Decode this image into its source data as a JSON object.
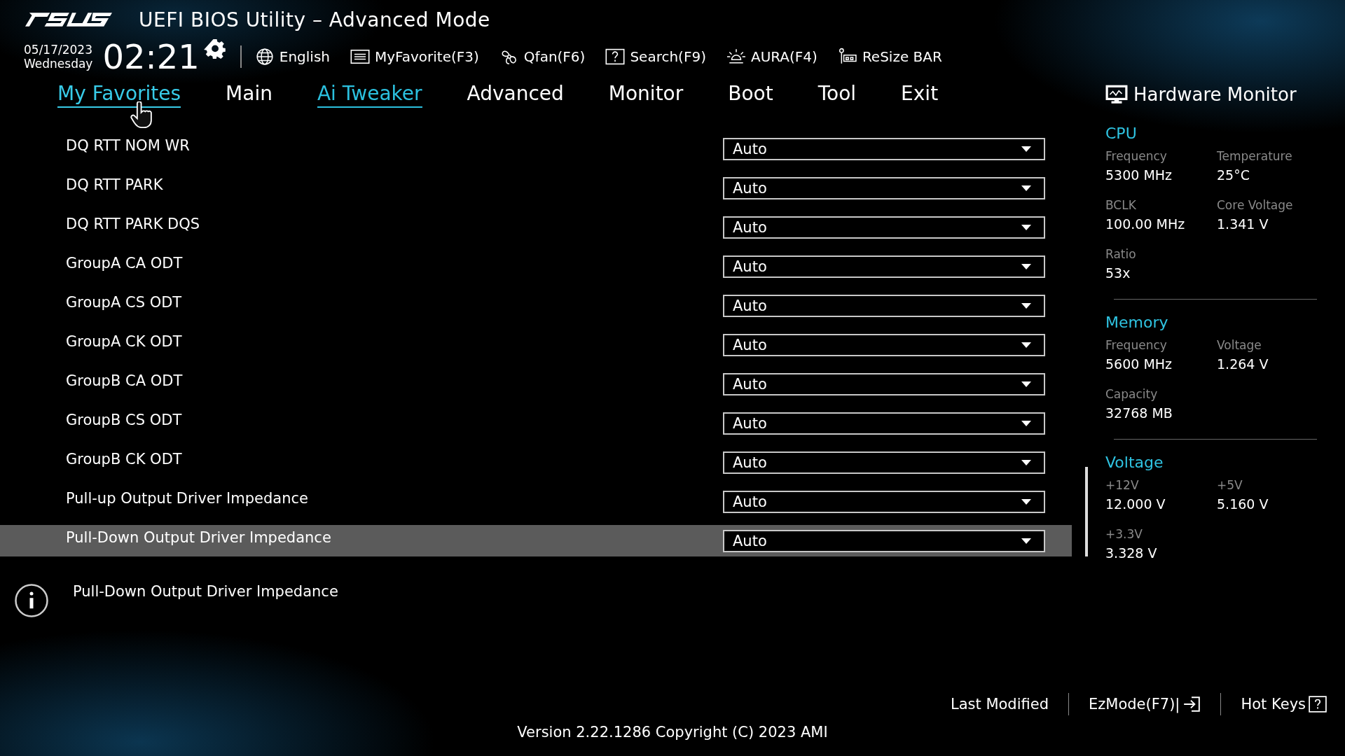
{
  "header": {
    "title": "UEFI BIOS Utility – Advanced Mode",
    "date": "05/17/2023",
    "weekday": "Wednesday",
    "time": "02:21"
  },
  "toolbar": [
    {
      "kind": "globe",
      "label": "English"
    },
    {
      "kind": "favorite",
      "label": "MyFavorite(F3)"
    },
    {
      "kind": "fan",
      "label": "Qfan(F6)"
    },
    {
      "kind": "search",
      "label": "Search(F9)"
    },
    {
      "kind": "aura",
      "label": "AURA(F4)"
    },
    {
      "kind": "bar",
      "label": "ReSize BAR"
    }
  ],
  "tabs": [
    {
      "label": "My Favorites",
      "selected": false,
      "hovered": true
    },
    {
      "label": "Main",
      "selected": false,
      "hovered": false
    },
    {
      "label": "Ai Tweaker",
      "selected": true,
      "hovered": false
    },
    {
      "label": "Advanced",
      "selected": false,
      "hovered": false
    },
    {
      "label": "Monitor",
      "selected": false,
      "hovered": false
    },
    {
      "label": "Boot",
      "selected": false,
      "hovered": false
    },
    {
      "label": "Tool",
      "selected": false,
      "hovered": false
    },
    {
      "label": "Exit",
      "selected": false,
      "hovered": false
    }
  ],
  "settings": [
    {
      "label": "DQ RTT NOM WR",
      "value": "Auto",
      "selected": false
    },
    {
      "label": "DQ RTT PARK",
      "value": "Auto",
      "selected": false
    },
    {
      "label": "DQ RTT PARK DQS",
      "value": "Auto",
      "selected": false
    },
    {
      "label": "GroupA CA ODT",
      "value": "Auto",
      "selected": false
    },
    {
      "label": "GroupA CS ODT",
      "value": "Auto",
      "selected": false
    },
    {
      "label": "GroupA CK ODT",
      "value": "Auto",
      "selected": false
    },
    {
      "label": "GroupB CA ODT",
      "value": "Auto",
      "selected": false
    },
    {
      "label": "GroupB CS ODT",
      "value": "Auto",
      "selected": false
    },
    {
      "label": "GroupB CK ODT",
      "value": "Auto",
      "selected": false
    },
    {
      "label": "Pull-up Output Driver Impedance",
      "value": "Auto",
      "selected": false
    },
    {
      "label": "Pull-Down Output Driver Impedance",
      "value": "Auto",
      "selected": true
    }
  ],
  "help": {
    "text": "Pull-Down Output Driver Impedance"
  },
  "hardware_monitor": {
    "title": "Hardware Monitor",
    "sections": [
      {
        "title": "CPU",
        "items": [
          {
            "label": "Frequency",
            "value": "5300 MHz"
          },
          {
            "label": "Temperature",
            "value": "25°C"
          },
          {
            "label": "BCLK",
            "value": "100.00 MHz"
          },
          {
            "label": "Core Voltage",
            "value": "1.341 V"
          },
          {
            "label": "Ratio",
            "value": "53x"
          }
        ]
      },
      {
        "title": "Memory",
        "items": [
          {
            "label": "Frequency",
            "value": "5600 MHz"
          },
          {
            "label": "Voltage",
            "value": "1.264 V"
          },
          {
            "label": "Capacity",
            "value": "32768 MB"
          }
        ]
      },
      {
        "title": "Voltage",
        "items": [
          {
            "label": "+12V",
            "value": "12.000 V"
          },
          {
            "label": "+5V",
            "value": "5.160 V"
          },
          {
            "label": "+3.3V",
            "value": "3.328 V"
          }
        ]
      }
    ]
  },
  "footer": {
    "last_modified": "Last Modified",
    "ezmode": "EzMode(F7)|",
    "hot_keys": "Hot Keys",
    "version": "Version 2.22.1286 Copyright (C) 2023 AMI"
  }
}
